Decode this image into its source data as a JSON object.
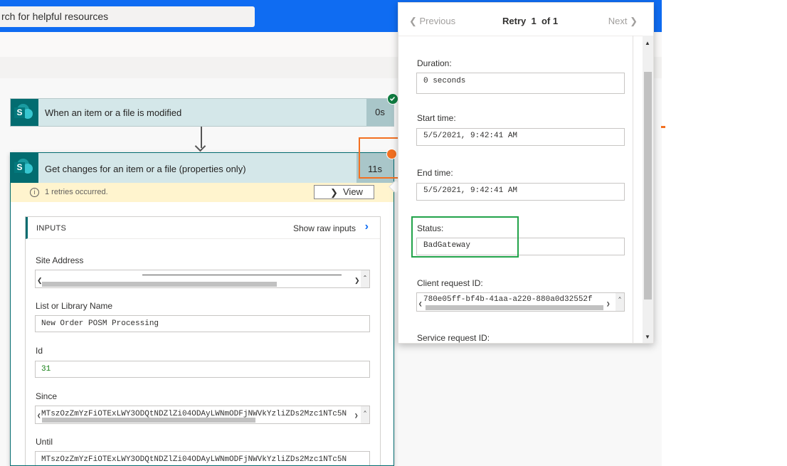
{
  "header": {
    "search_placeholder": "rch for helpful resources"
  },
  "flow": {
    "trigger": {
      "title": "When an item or a file is modified",
      "duration": "0s",
      "status": "succeeded"
    },
    "action": {
      "title": "Get changes for an item or a file (properties only)",
      "duration": "11s",
      "retry_notice": "1 retries occurred.",
      "view_label": "View",
      "inputs": {
        "heading": "INPUTS",
        "show_raw": "Show raw inputs",
        "fields": [
          {
            "label": "Site Address",
            "value": ""
          },
          {
            "label": "List or Library Name",
            "value": "New Order POSM Processing"
          },
          {
            "label": "Id",
            "value": "31"
          },
          {
            "label": "Since",
            "value": "MTszOzZmYzFiOTExLWY3ODQtNDZlZi04ODAyLWNmODFjNWVkYzliZDs2Mzc1NTc5N"
          },
          {
            "label": "Until",
            "value": "MTszOzZmYzFiOTExLWY3ODQtNDZlZi04ODAyLWNmODFjNWVkYzliZDs2Mzc1NTc5N"
          }
        ]
      }
    }
  },
  "retry_pane": {
    "previous_label": "Previous",
    "retry_word": "Retry",
    "retry_index": "1",
    "retry_total": "of 1",
    "next_label": "Next",
    "fields": [
      {
        "label": "Duration:",
        "value": "0 seconds"
      },
      {
        "label": "Start time:",
        "value": "5/5/2021, 9:42:41 AM"
      },
      {
        "label": "End time:",
        "value": "5/5/2021, 9:42:41 AM"
      },
      {
        "label": "Status:",
        "value": "BadGateway"
      },
      {
        "label": "Client request ID:",
        "value": "780e05ff-bf4b-41aa-a220-880a0d32552f"
      },
      {
        "label": "Service request ID:",
        "value": ""
      }
    ]
  },
  "colors": {
    "header_blue": "#0f6cf2",
    "sharepoint_teal": "#036c70",
    "highlight_orange": "#f37021",
    "highlight_green": "#22a34a",
    "success_green": "#107c41"
  }
}
